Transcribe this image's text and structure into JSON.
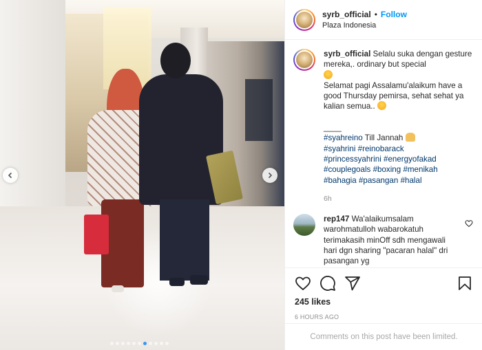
{
  "header": {
    "username": "syrb_official",
    "separator": "•",
    "follow_label": "Follow",
    "location": "Plaza Indonesia"
  },
  "media": {
    "carousel_dots": 11,
    "active_dot": 6,
    "prev_icon": "chevron-left-icon",
    "next_icon": "chevron-right-icon"
  },
  "caption": {
    "username": "syrb_official",
    "line1": "Selalu suka dengan gesture mereka,. ordinary but special",
    "emoji1": "heart-eyes-emoji",
    "line2": "Selamat pagi Assalamu'alaikum have a good Thursday pemirsa, sehat sehat ya kalian semua..",
    "emoji2": "wink-emoji",
    "divider": "____",
    "tags_line1_tag": "#syahreino",
    "tags_line1_text": " Till Jannah ",
    "emoji3": "raised-hands-emoji",
    "tags_line2": [
      "#syahrini",
      "#reinobarack"
    ],
    "tags_line3": [
      "#princessyahrini",
      "#energyofakad"
    ],
    "tags_line4": [
      "#couplegoals",
      "#boxing",
      "#menikah"
    ],
    "tags_line5": [
      "#bahagia",
      "#pasangan",
      "#halal"
    ],
    "time": "6h"
  },
  "comment": {
    "username": "rep147",
    "text": "Wa'alaikumsalam warohmatulloh wabarokatuh terimakasih minOff sdh mengawali hari dgn sharing \"pacaran halal\" dri pasangan yg"
  },
  "actions": {
    "like_icon": "heart-icon",
    "comment_icon": "comment-icon",
    "share_icon": "share-icon",
    "save_icon": "bookmark-icon",
    "likes": "245 likes",
    "posted": "6 HOURS AGO"
  },
  "footer": {
    "notice": "Comments on this post have been limited."
  },
  "colors": {
    "link": "#00376b",
    "follow": "#0095f6",
    "muted": "#8e8e8e",
    "active_dot": "#3897f0"
  }
}
